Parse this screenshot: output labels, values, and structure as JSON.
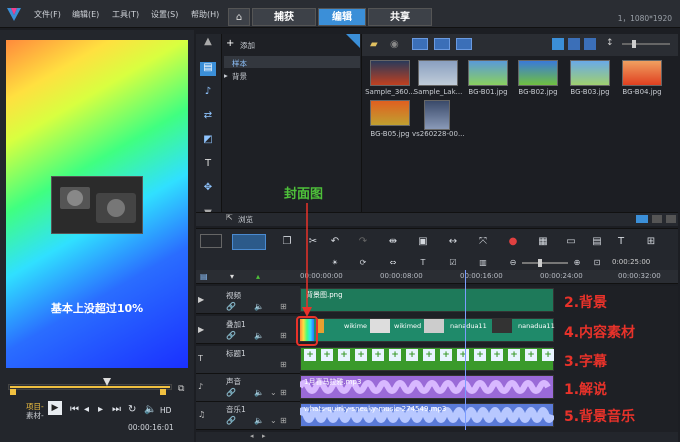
{
  "menu": [
    "文件(F)",
    "编辑(E)",
    "工具(T)",
    "设置(S)",
    "帮助(H)"
  ],
  "tabs": [
    "捕获",
    "编辑",
    "共享"
  ],
  "resolution": "1，1080*1920",
  "preview": {
    "caption": "基本上没超过10%",
    "timecode": "00:00:16:01"
  },
  "controls": {
    "project": "项目-",
    "clip": "素材-",
    "hd": "HD"
  },
  "library": {
    "add": "添加",
    "items": [
      "样本",
      "背景"
    ],
    "browse": "浏览",
    "media": [
      {
        "name": "Sample_360..."
      },
      {
        "name": "Sample_Lak..."
      },
      {
        "name": "BG-B01.jpg"
      },
      {
        "name": "BG-B02.jpg"
      },
      {
        "name": "BG-B03.jpg"
      },
      {
        "name": "BG-B04.jpg"
      },
      {
        "name": "BG-B05.jpg"
      },
      {
        "name": "vs260228-00..."
      }
    ]
  },
  "timeline": {
    "zoom_tc": "0:00:25:00",
    "ruler": [
      "00:00:00:00",
      "00:00:08:00",
      "00:00:16:00",
      "00:00:24:00",
      "00:00:32:00"
    ],
    "tracks": [
      {
        "name": "视频",
        "clip": "背景图.png"
      },
      {
        "name": "叠加1",
        "clips": [
          "wikime",
          "wikimed",
          "nanadua11",
          "nanadua11"
        ]
      },
      {
        "name": "标题1"
      },
      {
        "name": "声音",
        "clip": "1月喜马拉雅.mp3"
      },
      {
        "name": "音乐1",
        "clip": "whats-quirky-sneaky-music-274549.mp3"
      }
    ]
  },
  "annotations": {
    "cover": "封面图",
    "labels": [
      "2.背景",
      "4.内容素材",
      "3.字幕",
      "1.解说",
      "5.背景音乐"
    ]
  },
  "colors": {
    "accent": "#3b8fd8",
    "video_clip": "#1e7a5a",
    "overlay_clip": "#1f8a6a",
    "title_clip": "#3a9a2a",
    "voice_clip": "#9a6ad8",
    "music_clip": "#5a7ad8",
    "annotation": "#e8322a",
    "cover_label": "#4ec03a"
  }
}
